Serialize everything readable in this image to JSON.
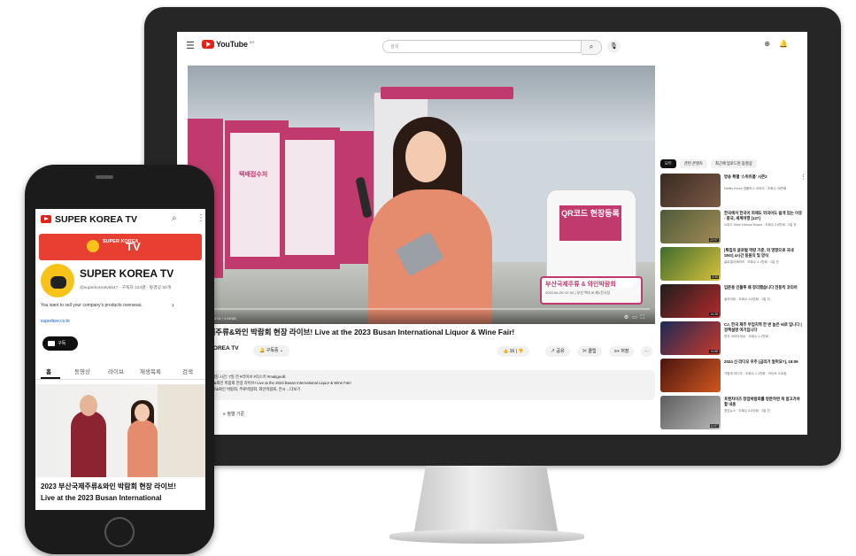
{
  "desktop": {
    "app_name": "YouTube",
    "app_suffix": "KR",
    "search_placeholder": "검색",
    "player": {
      "progress": 0.0,
      "time": "1:01 / 1:16:36",
      "overlay_title": "부산국제주류 & 와인박람회",
      "overlay_date": "2023.06.29~07.02 | 부산 벡스코 제1전시장",
      "booth_sign": "택배접수처",
      "qr_label": "QR코드 현장등록"
    },
    "video_title": "부산국제주류&와인 박람회 현장 라이브! Live at the 2023 Busan International Liquor & Wine Fair!",
    "channel": {
      "name": "SUPER KOREA TV",
      "subs": "구독자 224명",
      "subscribe_label": "구독중"
    },
    "actions": {
      "like": "16",
      "share": "공유",
      "clip": "클립",
      "save": "저장"
    },
    "description": {
      "line1": "조회수 스트리밍 시간: 7일 전  #라이브 #리스키 #makgeolli",
      "line2": "부산국제주류&와인 박람회 현장 라이브! Live at the 2023 Busan International Liquor & Wine Fair!",
      "line3": "#부산국제주류&와인 박람회, 주류박람회, 와인박람회, 전시 ...더보기"
    },
    "sort_label": "정렬 기준",
    "chips": [
      "모두",
      "관련 콘텐츠",
      "최근에 업로드된 동영상"
    ],
    "recommendations": [
      {
        "title": "방송 특별 '스위트홈' 시즌2",
        "meta": "Netflix Korea 넷플릭스 코리아 · 조회수 28만회",
        "duration": ""
      },
      {
        "title": "한국에서 한국어 외에도 외국어도 쉽게 있는 이유 - 중국, 세계여행 [127]",
        "meta": "노마드 More Nomad Shaun · 조회수 2.6만회 · 2일 전",
        "duration": "22:07"
      },
      {
        "title": "[특집의 글로벌 역량 기준, 외 영향으로 국내 SNS] 4시간 동원의 및 양식",
        "meta": "글로벌국제비즈 · 조회수 4.1만회 · 1일 전",
        "duration": "3:30"
      },
      {
        "title": "입문용 인플루 왜 정리했습니다 전동킥 코리아",
        "meta": "솔직리뷰 · 조회수 3.5만회 · 1일 전",
        "duration": "14:28"
      },
      {
        "title": "CJ, 한국 제주 부업지역 한 번 높은 씨로 입니다 | 정책설명 여기입니다",
        "meta": "한국 코리아세상 · 조회수 2.1만회",
        "duration": "14:58"
      },
      {
        "title": "2024 신 라디오 우주 [금리가 얼마요?], 18:09",
        "meta": "가볍게 라디오 · 조회수 1.1만회 · 라이브 스트림",
        "duration": ""
      },
      {
        "title": "프랜차이즈 창업박람회를 방문하면 꼭 알고가야 할 내용",
        "meta": "창업뉴스 · 조회수 8.8천회 · 3일 전",
        "duration": "11:07"
      }
    ]
  },
  "mobile": {
    "app_title": "SUPER KOREA TV",
    "banner_small": "SUPER KOREA",
    "banner_tv": "TV",
    "channel_name": "SUPER KOREA TV",
    "handle": "@superkoreatv6847 · 구독자 224명 · 동영상 50개",
    "tagline": "You want to sell your company's products overseas.",
    "link": "superbee.co.kr",
    "subscribe_label": "구독",
    "tabs": [
      "홈",
      "동영상",
      "라이브",
      "재생목록",
      "검색"
    ],
    "video_title_line1": "2023 부산국제주류&와인 박람회 현장 라이브!",
    "video_title_line2": "Live at the 2023 Busan International"
  }
}
